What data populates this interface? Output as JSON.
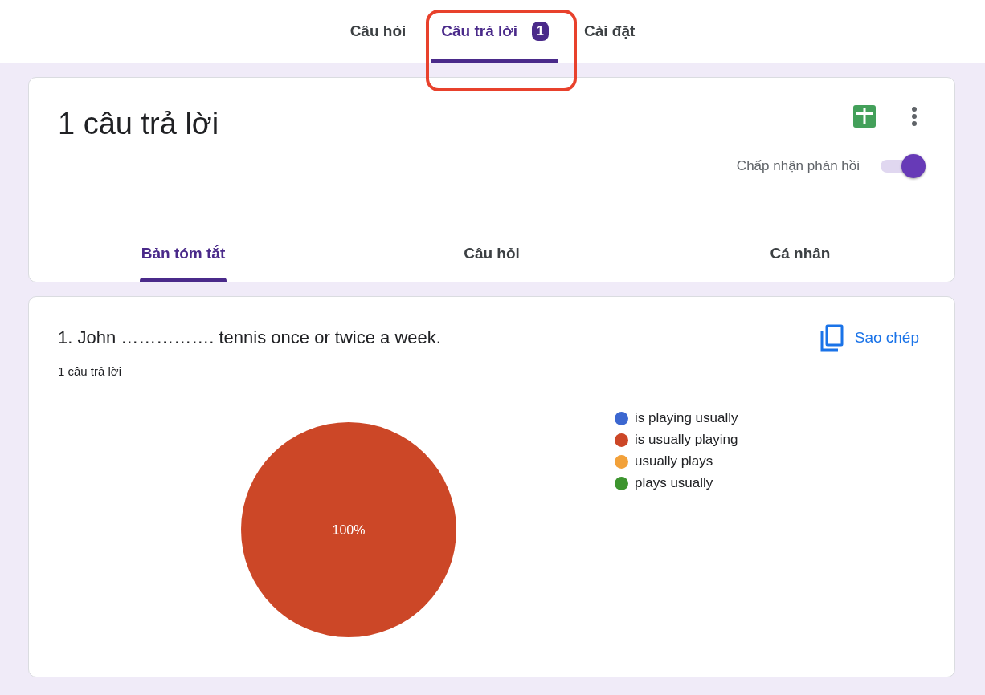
{
  "top_tabs": [
    {
      "label": "Câu hỏi",
      "selected": false
    },
    {
      "label": "Câu trả lời",
      "selected": true,
      "badge": "1"
    },
    {
      "label": "Cài đặt",
      "selected": false
    }
  ],
  "summary": {
    "title": "1 câu trả lời",
    "accepting": {
      "label": "Chấp nhận phản hồi",
      "on": true
    },
    "tabs": [
      {
        "label": "Bản tóm tắt",
        "selected": true
      },
      {
        "label": "Câu hỏi",
        "selected": false
      },
      {
        "label": "Cá nhân",
        "selected": false
      }
    ]
  },
  "question": {
    "title": "1. John ……………. tennis once or twice a week.",
    "copy_label": "Sao chép",
    "count": "1 câu trả lời",
    "chart_data": {
      "type": "pie",
      "categories": [
        "is playing usually",
        "is usually playing",
        "usually plays",
        "plays usually"
      ],
      "colors": [
        "#3c67d0",
        "#cc4727",
        "#f2a13a",
        "#3d952f"
      ],
      "values": [
        0,
        100,
        0,
        0
      ],
      "data_labels": true,
      "value_labels": [
        null,
        "100%",
        null,
        null
      ]
    }
  }
}
